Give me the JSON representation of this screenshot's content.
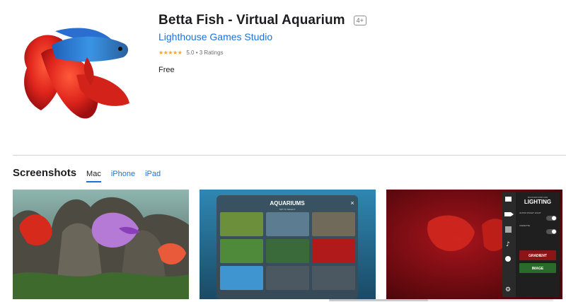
{
  "app": {
    "title": "Betta Fish - Virtual Aquarium",
    "age_rating": "4+",
    "developer": "Lighthouse Games Studio",
    "stars": "★★★★★",
    "rating_text": "5.0 • 3 Ratings",
    "price": "Free",
    "icon": "betta-fish-app-icon"
  },
  "screenshots": {
    "title": "Screenshots",
    "tabs": [
      {
        "label": "Mac",
        "active": true
      },
      {
        "label": "iPhone",
        "active": false
      },
      {
        "label": "iPad",
        "active": false
      }
    ],
    "shot2": {
      "panel_title": "AQUARIUMS",
      "panel_subtitle": "TAP TO SELECT",
      "close": "×"
    },
    "shot3": {
      "panel_small": "BACKGROUND AND",
      "panel_title": "LIGHTING",
      "ultra_violet": "ULTRA VIOLET LIGHT",
      "vignette": "VIGNETTE",
      "gradient": "GRADIENT",
      "image": "IMAGE"
    }
  },
  "colors": {
    "link": "#1a73d9",
    "fish_red": "#e0261d",
    "fish_blue": "#2f7fd6",
    "lighting_bg": "#6b0a0f"
  }
}
